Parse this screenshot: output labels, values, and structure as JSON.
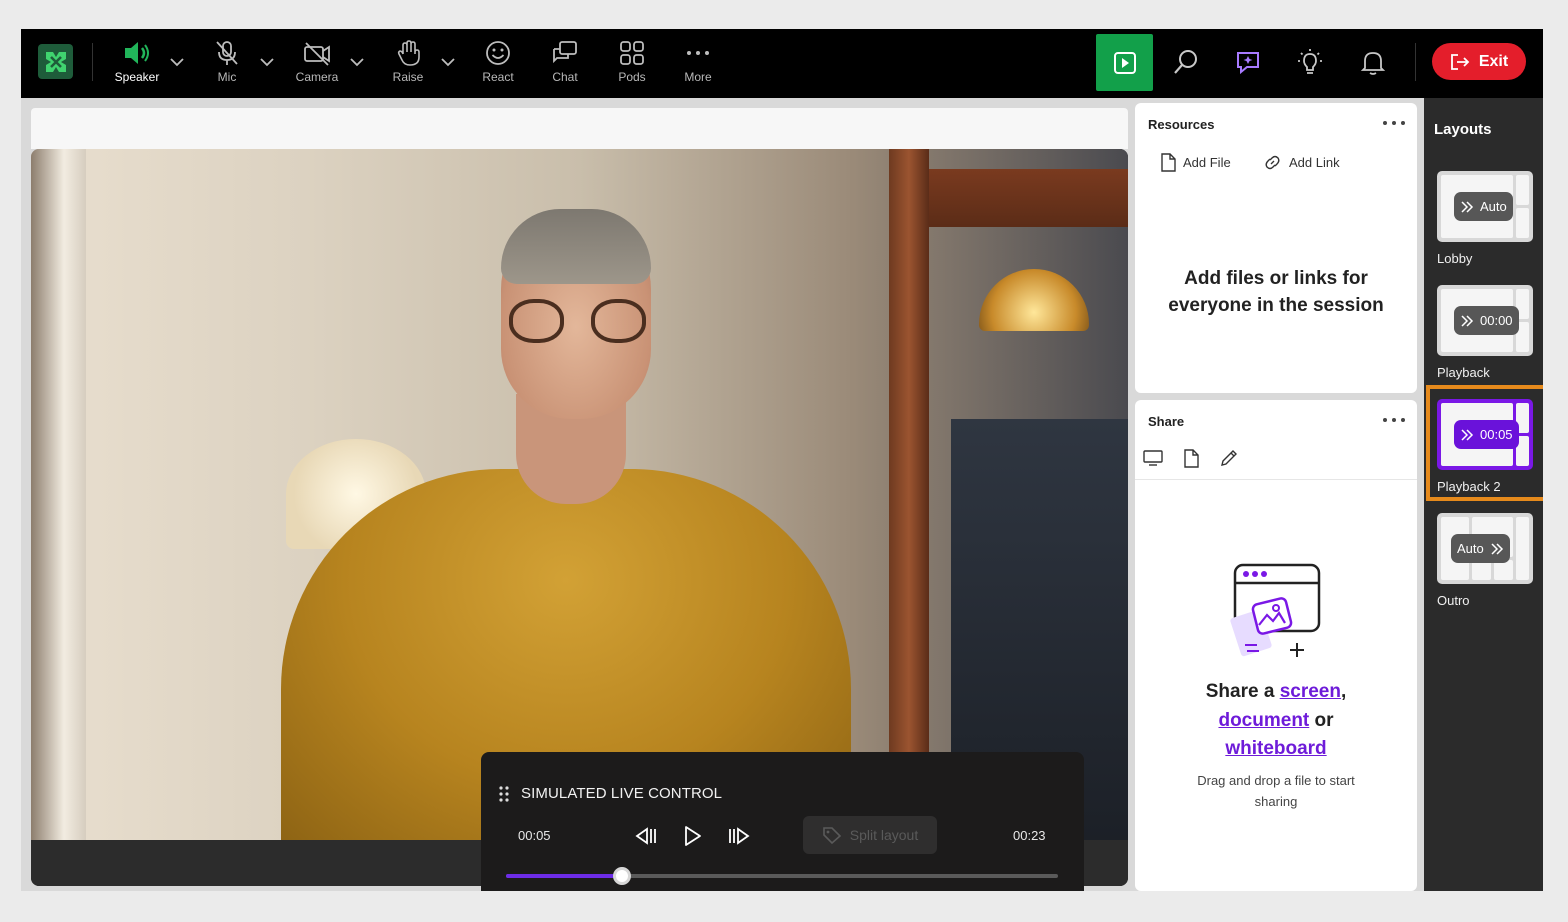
{
  "toolbar": {
    "speaker": "Speaker",
    "mic": "Mic",
    "camera": "Camera",
    "raise": "Raise",
    "react": "React",
    "chat": "Chat",
    "pods": "Pods",
    "more": "More",
    "exit": "Exit"
  },
  "slc": {
    "title": "SIMULATED LIVE CONTROL",
    "current_time": "00:05",
    "total_time": "00:23",
    "split_layout": "Split layout",
    "progress": 0.21
  },
  "resources": {
    "title": "Resources",
    "add_file": "Add File",
    "add_link": "Add Link",
    "empty_line1": "Add files or links for",
    "empty_line2": "everyone in the session"
  },
  "share": {
    "title": "Share",
    "head_prefix": "Share a",
    "screen": "screen",
    "comma": ",",
    "document": "document",
    "or": "or",
    "whiteboard": "whiteboard",
    "sub_line1": "Drag and drop a file to start",
    "sub_line2": "sharing"
  },
  "layouts": {
    "title": "Layouts",
    "items": [
      {
        "label": "Lobby",
        "pill": "Auto"
      },
      {
        "label": "Playback",
        "pill": "00:00"
      },
      {
        "label": "Playback 2",
        "pill": "00:05"
      },
      {
        "label": "Outro",
        "pill": "Auto"
      }
    ]
  },
  "colors": {
    "accent_purple": "#6e1bd9",
    "go_green": "#12a04a",
    "exit_red": "#e41e2b",
    "selection_orange": "#e68a1c"
  }
}
